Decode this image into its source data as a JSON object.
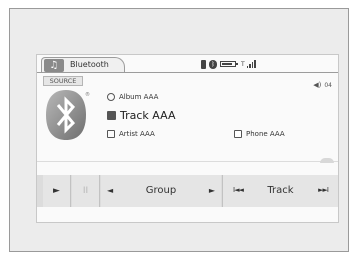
{
  "header": {
    "tab_icon": "music-note-icon",
    "tab_label": "Bluetooth",
    "status_icons": [
      "phone-icon",
      "bluetooth-icon",
      "battery-icon",
      "signal-icon"
    ],
    "signal_prefix": "T"
  },
  "source": {
    "label": "SOURCE"
  },
  "volume": {
    "icon": "speaker-icon",
    "value": "04"
  },
  "info": {
    "album": "Album AAA",
    "track": "Track AAA",
    "artist": "Artist AAA",
    "phone": "Phone AAA"
  },
  "controls": {
    "play_symbol": "►",
    "pause_symbol": "II",
    "group_prev_symbol": "◄",
    "group_label": "Group",
    "group_next_symbol": "►",
    "track_prev_symbol": "I◄◄",
    "track_label": "Track",
    "track_next_symbol": "►►I"
  }
}
